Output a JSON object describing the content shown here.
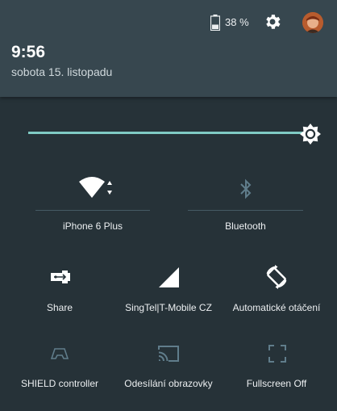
{
  "status": {
    "battery_text": "38 %"
  },
  "header": {
    "time": "9:56",
    "date": "sobota 15. listopadu"
  },
  "brightness": {
    "level_percent": 96
  },
  "tiles": {
    "wifi": {
      "label": "iPhone 6 Plus",
      "icon": "wifi-icon"
    },
    "bluetooth": {
      "label": "Bluetooth",
      "icon": "bluetooth-icon"
    },
    "share": {
      "label": "Share",
      "icon": "usb-share-icon"
    },
    "signal": {
      "label": "SingTel|T-Mobile CZ",
      "icon": "cellular-signal-icon"
    },
    "rotation": {
      "label": "Automatické otáčení",
      "icon": "auto-rotate-icon"
    },
    "shield": {
      "label": "SHIELD controller",
      "icon": "gamepad-icon"
    },
    "cast": {
      "label": "Odesílání obrazovky",
      "icon": "cast-icon"
    },
    "fullscreen": {
      "label": "Fullscreen Off",
      "icon": "fullscreen-icon"
    }
  },
  "colors": {
    "background": "#263238",
    "header": "#37474f",
    "accent": "#80cbc4",
    "inactive_icon": "#607d8b"
  }
}
